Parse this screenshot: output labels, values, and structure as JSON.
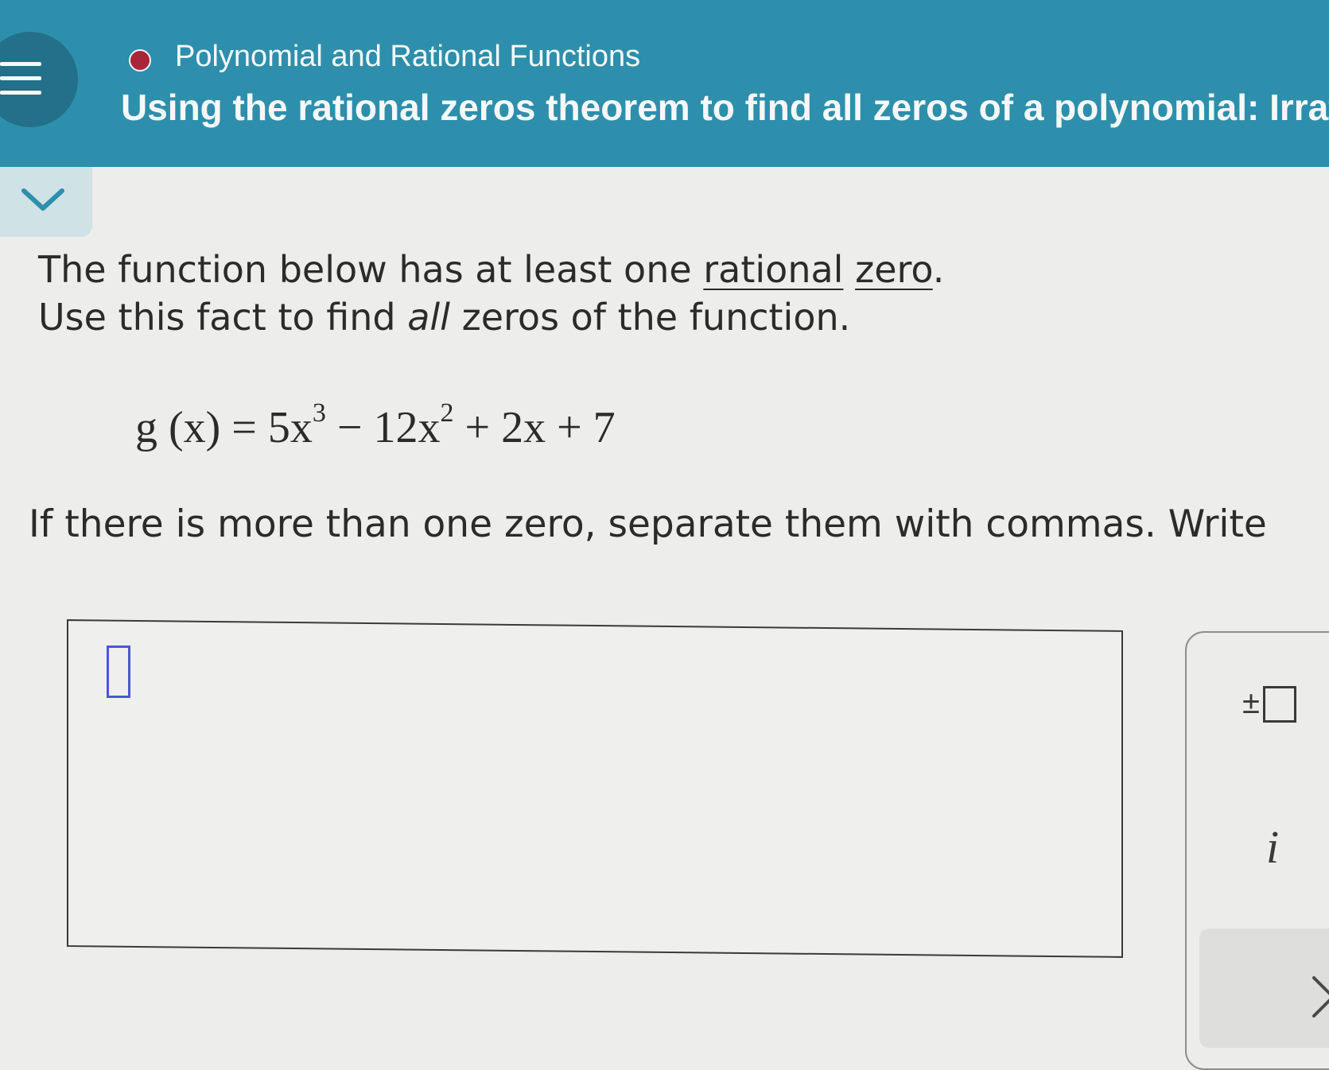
{
  "header": {
    "topic": "Polynomial and Rational Functions",
    "title": "Using the rational zeros theorem to find all zeros of a polynomial: Irrati",
    "status_color": "#a8263a",
    "background_color": "#2d8fab"
  },
  "problem": {
    "line1_prefix": "The function below has at least one ",
    "link_rational": "rational",
    "link_zero": "zero",
    "line1_suffix": ".",
    "line2_prefix": "Use this fact to find ",
    "line2_emph": "all",
    "line2_suffix": " zeros of the function.",
    "instruction": "If there is more than one zero, separate them with commas. Write"
  },
  "equation": {
    "lhs": "g (x) = 5x",
    "exp1": "3",
    "mid": " − 12x",
    "exp2": "2",
    "rhs": " + 2x + 7"
  },
  "answer": {
    "value": ""
  },
  "keypad": {
    "plus_minus_label": "±",
    "i_label": "i"
  },
  "icons": {
    "menu": "hamburger-menu-icon",
    "collapse": "chevron-down-icon",
    "next": "chevron-right-icon"
  }
}
